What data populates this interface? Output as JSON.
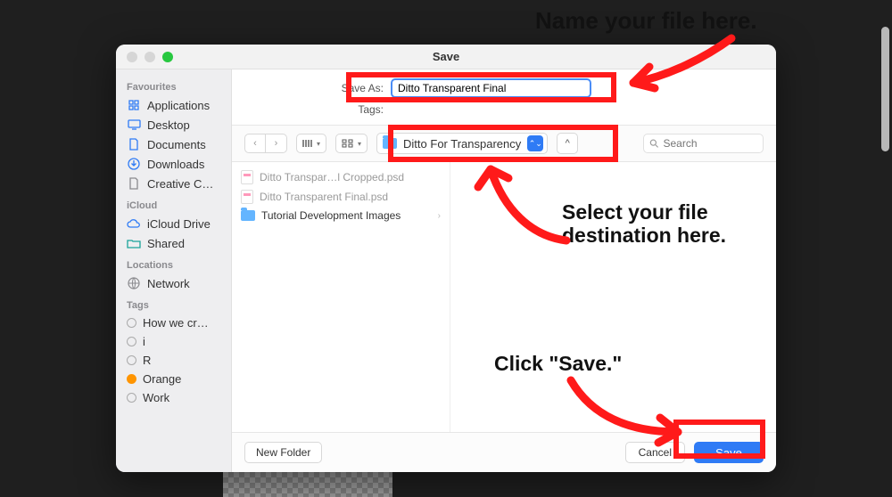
{
  "window": {
    "title": "Save"
  },
  "sidebar": {
    "sections": {
      "favourites": "Favourites",
      "icloud": "iCloud",
      "locations": "Locations",
      "tags": "Tags"
    },
    "fav": [
      {
        "label": "Applications"
      },
      {
        "label": "Desktop"
      },
      {
        "label": "Documents"
      },
      {
        "label": "Downloads"
      },
      {
        "label": "Creative C…"
      }
    ],
    "icloud": [
      {
        "label": "iCloud Drive"
      },
      {
        "label": "Shared"
      }
    ],
    "locations": [
      {
        "label": "Network"
      }
    ],
    "tags": [
      {
        "label": "How we cr…"
      },
      {
        "label": "i"
      },
      {
        "label": "R"
      },
      {
        "label": "Orange"
      },
      {
        "label": "Work"
      }
    ]
  },
  "saveAs": {
    "label": "Save As:",
    "value": "Ditto Transparent Final"
  },
  "tags": {
    "label": "Tags:"
  },
  "folderPicker": {
    "label": "Ditto For Transparency"
  },
  "search": {
    "placeholder": "Search"
  },
  "files": [
    {
      "label": "Ditto Transpar…l Cropped.psd",
      "kind": "psd"
    },
    {
      "label": "Ditto Transparent Final.psd",
      "kind": "psd"
    },
    {
      "label": "Tutorial Development Images",
      "kind": "folder"
    }
  ],
  "footer": {
    "newFolder": "New Folder",
    "cancel": "Cancel",
    "save": "Save"
  },
  "annotations": {
    "a1": "Name your file here.",
    "a2a": "Select your file",
    "a2b": "destination here.",
    "a3": "Click \"Save.\""
  }
}
